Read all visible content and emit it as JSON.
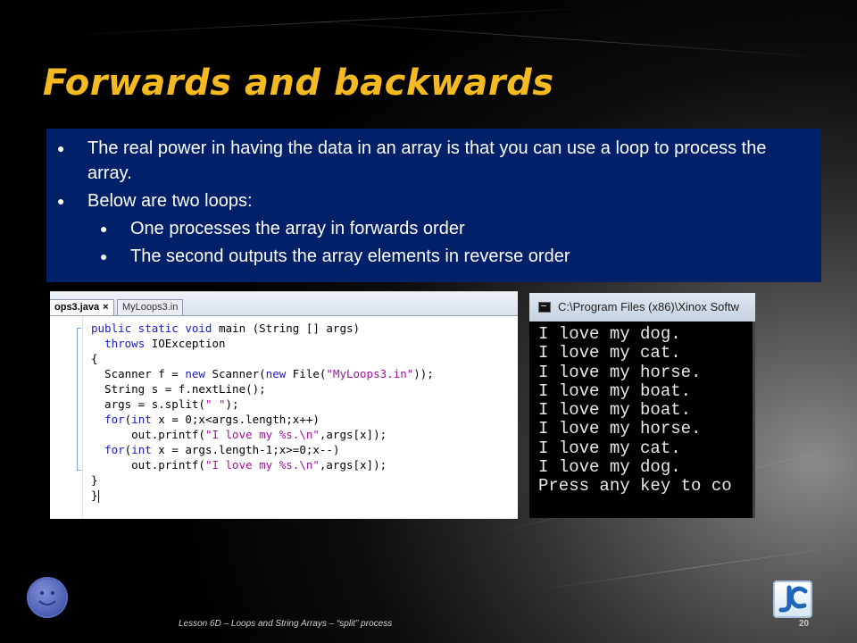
{
  "slide": {
    "title": "Forwards and backwards",
    "bullets": [
      {
        "level": 1,
        "text": "The real power in having the data in an array is that you can use a loop to process the array."
      },
      {
        "level": 1,
        "text": "Below are two loops:"
      },
      {
        "level": 2,
        "text": "One processes the array in forwards order"
      },
      {
        "level": 2,
        "text": "The second outputs the array elements in reverse order"
      }
    ],
    "footer": "Lesson 6D – Loops and String Arrays – “split” process",
    "page_number": "20",
    "icons": {
      "bullet": "bullet-dot-icon",
      "smiley": "smiley-face-icon",
      "logo": "jc-logo-icon"
    },
    "colors": {
      "title": "#f5b922",
      "bullet_box": "#00206a"
    }
  },
  "editor": {
    "tabs": [
      {
        "label": "ops3.java",
        "close": "×",
        "active": true
      },
      {
        "label": "MyLoops3.in",
        "active": false
      }
    ]
  },
  "console": {
    "title": "C:\\Program Files (x86)\\Xinox Softw",
    "output_lines": [
      "I love my dog.",
      "I love my cat.",
      "I love my horse.",
      "I love my boat.",
      "I love my boat.",
      "I love my horse.",
      "I love my cat.",
      "I love my dog.",
      "Press any key to co"
    ]
  }
}
